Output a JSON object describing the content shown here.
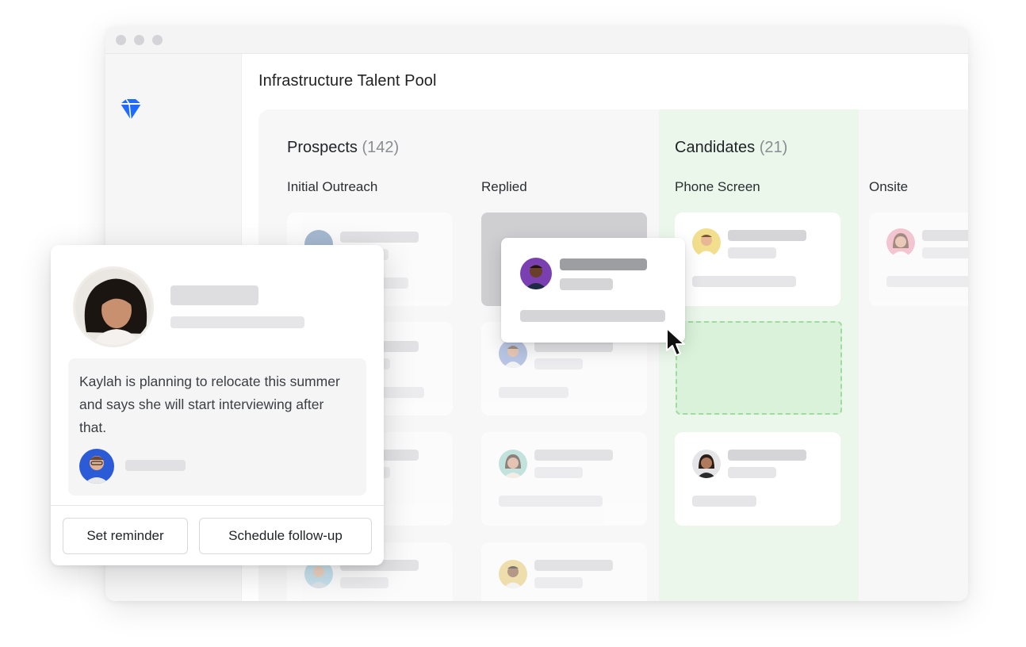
{
  "page": {
    "title": "Infrastructure Talent Pool"
  },
  "pipeline": {
    "prospects": {
      "label": "Prospects",
      "count": "(142)"
    },
    "candidates": {
      "label": "Candidates",
      "count": "(21)"
    },
    "columns": [
      "Initial Outreach",
      "Replied",
      "Phone Screen",
      "Onsite"
    ]
  },
  "note": {
    "text": "Kaylah is planning to relocate this summer and says she will start interviewing after that."
  },
  "actions": {
    "set_reminder": "Set reminder",
    "schedule_follow_up": "Schedule follow-up"
  },
  "icons": {
    "logo": "diamond-logo-icon",
    "cursor": "mouse-pointer-icon"
  },
  "colors": {
    "accent": "#1f6bff",
    "candidates_bg": "#eaf7ea",
    "dropzone_border": "#9edb9e"
  }
}
